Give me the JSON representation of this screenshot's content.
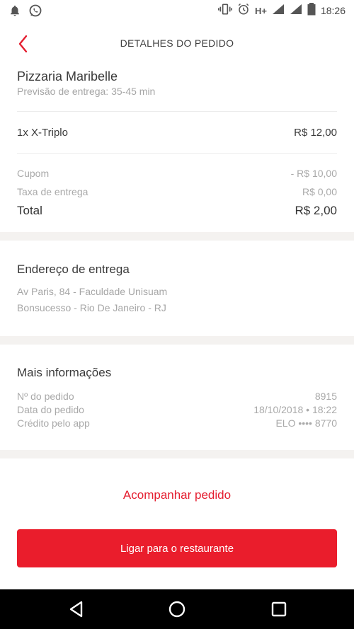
{
  "status_bar": {
    "time": "18:26",
    "network": "H+",
    "icons": [
      "notification-bell-icon",
      "whatsapp-icon",
      "vibrate-icon",
      "alarm-icon",
      "signal-icon",
      "battery-icon"
    ]
  },
  "header": {
    "title": "DETALHES DO PEDIDO",
    "back_icon": "chevron-left-icon"
  },
  "order": {
    "restaurant": "Pizzaria Maribelle",
    "eta": "Previsão de entrega: 35-45 min",
    "item": {
      "label": "1x X-Triplo",
      "price": "R$ 12,00"
    },
    "coupon": {
      "label": "Cupom",
      "value": "- R$ 10,00"
    },
    "delivery_fee": {
      "label": "Taxa de entrega",
      "value": "R$ 0,00"
    },
    "total": {
      "label": "Total",
      "value": "R$ 2,00"
    }
  },
  "address": {
    "title": "Endereço de entrega",
    "line1": "Av Paris, 84 - Faculdade Unisuam",
    "line2": "Bonsucesso - Rio De Janeiro - RJ"
  },
  "info": {
    "title": "Mais informações",
    "order_number": {
      "label": "Nº do pedido",
      "value": "8915"
    },
    "order_date": {
      "label": "Data do pedido",
      "value": "18/10/2018 • 18:22"
    },
    "payment": {
      "label": "Crédito pelo app",
      "value": "ELO •••• 8770"
    }
  },
  "actions": {
    "track": "Acompanhar pedido",
    "call": "Ligar para o restaurante"
  },
  "colors": {
    "accent": "#ea1d2c",
    "band": "#f4f2f0",
    "muted_text": "#a6a6a6"
  },
  "nav_bar": {
    "icons": [
      "back-triangle-icon",
      "home-circle-icon",
      "recents-square-icon"
    ]
  }
}
